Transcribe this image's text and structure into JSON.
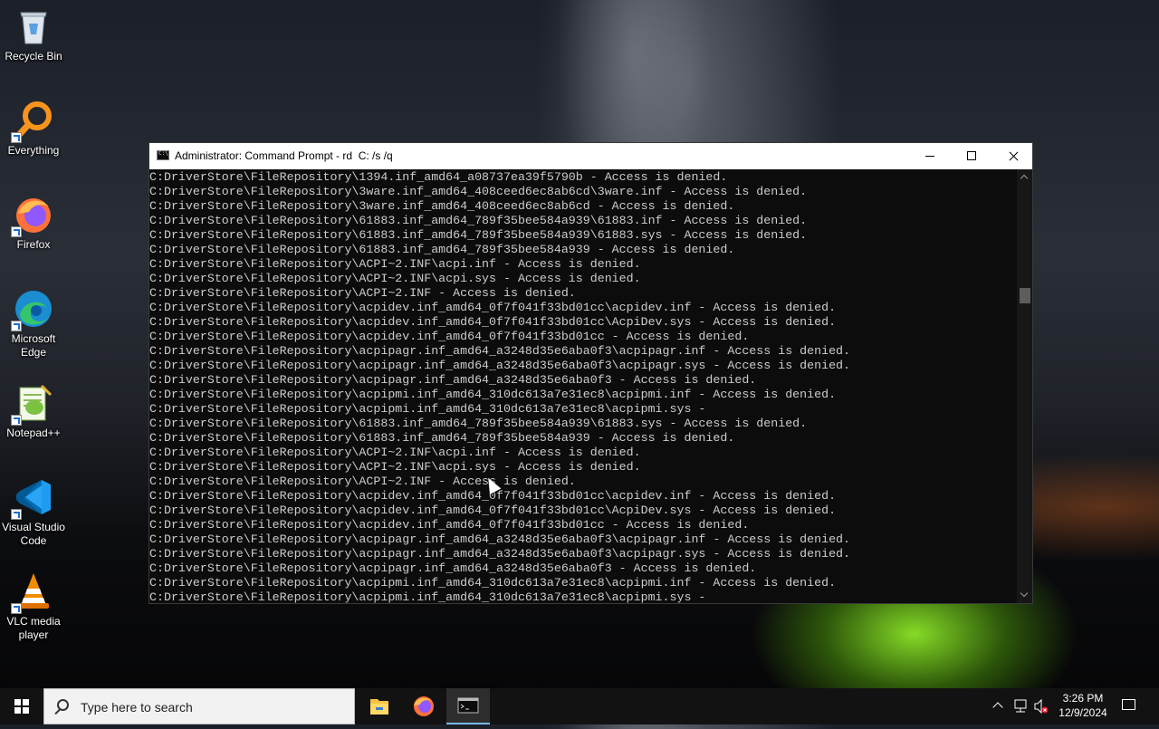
{
  "desktop": {
    "icons": [
      {
        "label": "Recycle Bin"
      },
      {
        "label": "Everything"
      },
      {
        "label": "Firefox"
      },
      {
        "label": "Microsoft Edge"
      },
      {
        "label": "Notepad++"
      },
      {
        "label": "Visual Studio Code"
      },
      {
        "label": "VLC media player"
      }
    ]
  },
  "cmd_window": {
    "title": "Administrator: Command Prompt - rd  C: /s /q",
    "lines": [
      "C:DriverStore\\FileRepository\\1394.inf_amd64_a08737ea39f5790b - Access is denied.",
      "C:DriverStore\\FileRepository\\3ware.inf_amd64_408ceed6ec8ab6cd\\3ware.inf - Access is denied.",
      "C:DriverStore\\FileRepository\\3ware.inf_amd64_408ceed6ec8ab6cd - Access is denied.",
      "C:DriverStore\\FileRepository\\61883.inf_amd64_789f35bee584a939\\61883.inf - Access is denied.",
      "C:DriverStore\\FileRepository\\61883.inf_amd64_789f35bee584a939\\61883.sys - Access is denied.",
      "C:DriverStore\\FileRepository\\61883.inf_amd64_789f35bee584a939 - Access is denied.",
      "C:DriverStore\\FileRepository\\ACPI~2.INF\\acpi.inf - Access is denied.",
      "C:DriverStore\\FileRepository\\ACPI~2.INF\\acpi.sys - Access is denied.",
      "C:DriverStore\\FileRepository\\ACPI~2.INF - Access is denied.",
      "C:DriverStore\\FileRepository\\acpidev.inf_amd64_0f7f041f33bd01cc\\acpidev.inf - Access is denied.",
      "C:DriverStore\\FileRepository\\acpidev.inf_amd64_0f7f041f33bd01cc\\AcpiDev.sys - Access is denied.",
      "C:DriverStore\\FileRepository\\acpidev.inf_amd64_0f7f041f33bd01cc - Access is denied.",
      "C:DriverStore\\FileRepository\\acpipagr.inf_amd64_a3248d35e6aba0f3\\acpipagr.inf - Access is denied.",
      "C:DriverStore\\FileRepository\\acpipagr.inf_amd64_a3248d35e6aba0f3\\acpipagr.sys - Access is denied.",
      "C:DriverStore\\FileRepository\\acpipagr.inf_amd64_a3248d35e6aba0f3 - Access is denied.",
      "C:DriverStore\\FileRepository\\acpipmi.inf_amd64_310dc613a7e31ec8\\acpipmi.inf - Access is denied.",
      "C:DriverStore\\FileRepository\\acpipmi.inf_amd64_310dc613a7e31ec8\\acpipmi.sys -",
      "C:DriverStore\\FileRepository\\61883.inf_amd64_789f35bee584a939\\61883.sys - Access is denied.",
      "C:DriverStore\\FileRepository\\61883.inf_amd64_789f35bee584a939 - Access is denied.",
      "C:DriverStore\\FileRepository\\ACPI~2.INF\\acpi.inf - Access is denied.",
      "C:DriverStore\\FileRepository\\ACPI~2.INF\\acpi.sys - Access is denied.",
      "C:DriverStore\\FileRepository\\ACPI~2.INF - Access is denied.",
      "C:DriverStore\\FileRepository\\acpidev.inf_amd64_0f7f041f33bd01cc\\acpidev.inf - Access is denied.",
      "C:DriverStore\\FileRepository\\acpidev.inf_amd64_0f7f041f33bd01cc\\AcpiDev.sys - Access is denied.",
      "C:DriverStore\\FileRepository\\acpidev.inf_amd64_0f7f041f33bd01cc - Access is denied.",
      "C:DriverStore\\FileRepository\\acpipagr.inf_amd64_a3248d35e6aba0f3\\acpipagr.inf - Access is denied.",
      "C:DriverStore\\FileRepository\\acpipagr.inf_amd64_a3248d35e6aba0f3\\acpipagr.sys - Access is denied.",
      "C:DriverStore\\FileRepository\\acpipagr.inf_amd64_a3248d35e6aba0f3 - Access is denied.",
      "C:DriverStore\\FileRepository\\acpipmi.inf_amd64_310dc613a7e31ec8\\acpipmi.inf - Access is denied.",
      "C:DriverStore\\FileRepository\\acpipmi.inf_amd64_310dc613a7e31ec8\\acpipmi.sys -"
    ]
  },
  "taskbar": {
    "search_placeholder": "Type here to search",
    "clock_time": "3:26 PM",
    "clock_date": "12/9/2024"
  },
  "colors": {
    "console_bg": "#0c0c0c",
    "console_text": "#cccccc",
    "taskbar_bg": "#121212",
    "active_indicator": "#76b9ed"
  }
}
